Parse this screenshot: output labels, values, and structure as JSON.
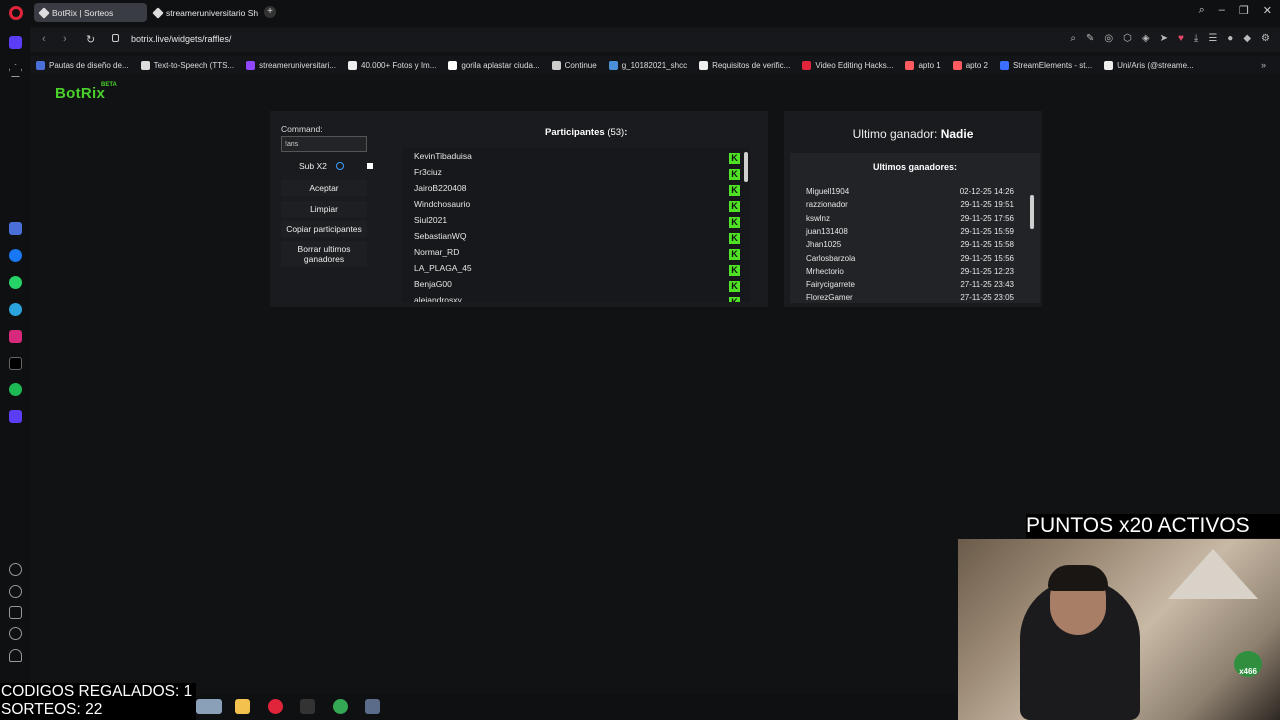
{
  "browser": {
    "tabs": [
      {
        "label": "BotRix | Sorteos",
        "active": true
      },
      {
        "label": "streameruniversitario Sho",
        "active": false
      }
    ],
    "new_tab_label": "+",
    "url": "botrix.live/widgets/raffles/",
    "bookmarks": [
      {
        "label": "Pautas de diseño de...",
        "color": "#4a6fd8"
      },
      {
        "label": "Text-to-Speech (TTS...",
        "color": "#dddddd"
      },
      {
        "label": "streameruniversitari...",
        "color": "#9146ff"
      },
      {
        "label": "40.000+ Fotos y Im...",
        "color": "#eeeeee"
      },
      {
        "label": "gorila aplastar ciuda...",
        "color": "#ffffff"
      },
      {
        "label": "Continue",
        "color": "#cccccc"
      },
      {
        "label": "g_10182021_shcc",
        "color": "#4a90d9"
      },
      {
        "label": "Requisitos de verific...",
        "color": "#eeeeee"
      },
      {
        "label": "Video Editing Hacks...",
        "color": "#e0243a"
      },
      {
        "label": "apto 1",
        "color": "#ff5a5f"
      },
      {
        "label": "apto 2",
        "color": "#ff5a5f"
      },
      {
        "label": "StreamElements - st...",
        "color": "#3b6fff"
      },
      {
        "label": "Uni/Aris (@streame...",
        "color": "#eeeeee"
      }
    ]
  },
  "app": {
    "logo": "BotRix",
    "logo_badge": "BETA"
  },
  "controls": {
    "command_label": "Command:",
    "command_value": "!aris",
    "sub_label": "Sub X2",
    "buttons": [
      "Aceptar",
      "Limpiar",
      "Copiar participantes",
      "Borrar ultimos ganadores"
    ]
  },
  "participants": {
    "title": "Participantes",
    "count": "(53)",
    "colon": ":",
    "platform_badge": "K",
    "names": [
      "KevinTibaduisa",
      "Fr3ciuz",
      "JairoB220408",
      "Windchosaurio",
      "Siul2021",
      "SebastianWQ",
      "Normar_RD",
      "LA_PLAGA_45",
      "BenjaG00",
      "alejandrosxy"
    ]
  },
  "winners": {
    "last_winner_label": "Ultimo ganador:",
    "last_winner_value": "Nadie",
    "list_title": "Ultimos ganadores:",
    "rows": [
      {
        "name": "Miguell1904",
        "date": "02-12-25 14:26"
      },
      {
        "name": "razzionador",
        "date": "29-11-25 19:51"
      },
      {
        "name": "kswlnz",
        "date": "29-11-25 17:56"
      },
      {
        "name": "juan131408",
        "date": "29-11-25 15:59"
      },
      {
        "name": "Jhan1025",
        "date": "29-11-25 15:58"
      },
      {
        "name": "Carlosbarzola",
        "date": "29-11-25 15:56"
      },
      {
        "name": "Mrhectorio",
        "date": "29-11-25 12:23"
      },
      {
        "name": "Fairycigarrete",
        "date": "27-11-25 23:43"
      },
      {
        "name": "FlorezGamer",
        "date": "27-11-25 23:05"
      }
    ]
  },
  "overlay": {
    "points_banner": "PUNTOS x20 ACTIVOS",
    "codes_line": "CODIGOS REGALADOS: 1",
    "raffles_line": "SORTEOS: 22",
    "cam_badge": "x466"
  }
}
